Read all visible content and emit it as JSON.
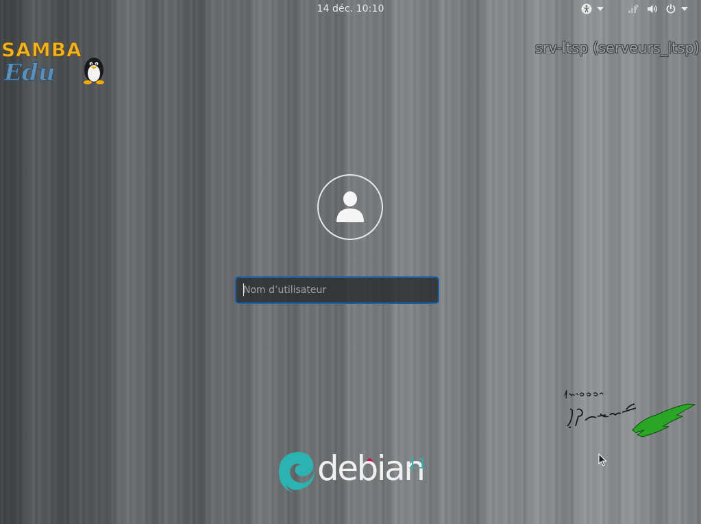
{
  "top_bar": {
    "clock": "14 déc.  10:10",
    "icons": [
      "accessibility-icon",
      "network-icon",
      "volume-icon",
      "power-icon"
    ]
  },
  "branding": {
    "samba_logo_text": "SAMBA",
    "samba_logo_subtext": "Edu",
    "host_label": "srv-ltsp (serveurs_ltsp)",
    "debian_text": "debian",
    "debian_version": "11",
    "signature_text": "Lycée J. Prévert"
  },
  "login": {
    "username_placeholder": "Nom d’utilisateur",
    "username_value": ""
  },
  "colors": {
    "accent": "#1b5fa8",
    "samba_orange": "#f0b323",
    "samba_blue": "#5e8fb5",
    "debian_red": "#d70751",
    "debian_teal": "#2ab3b0"
  }
}
